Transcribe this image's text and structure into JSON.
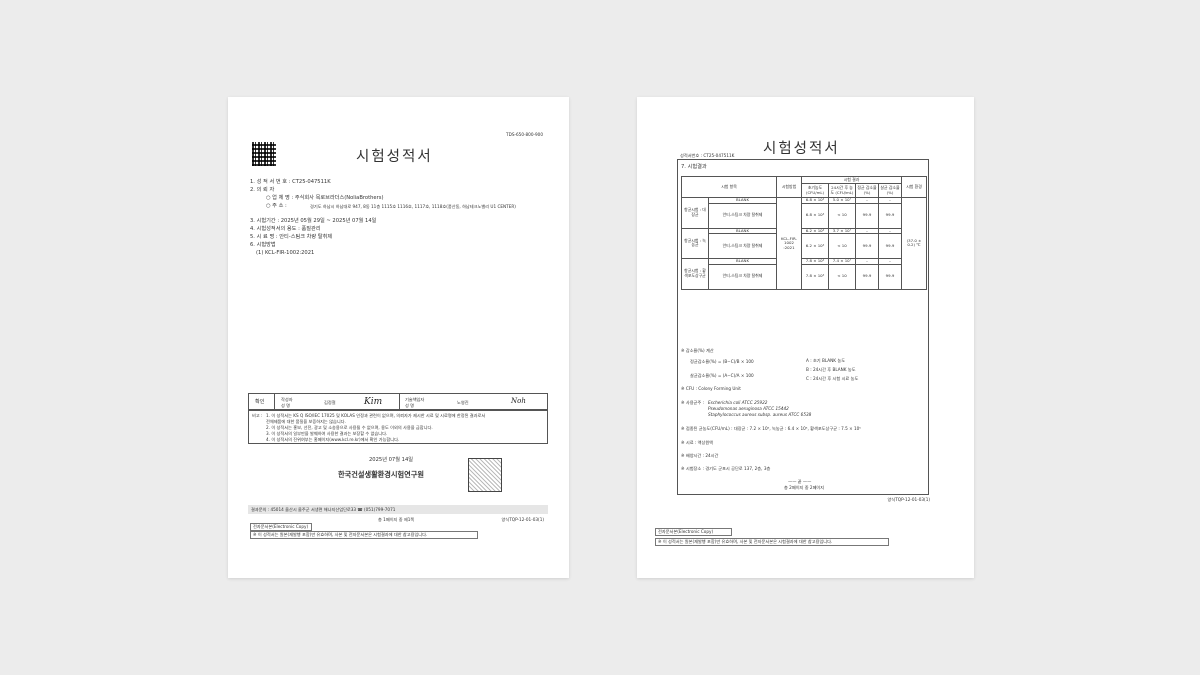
{
  "page1": {
    "doc_code": "TDS-650-800-900",
    "title": "시험성적서",
    "items": [
      {
        "label": "1. 성 적 서 번 호 :",
        "value": "CT25-047511K"
      },
      {
        "label": "2. 의 뢰 자",
        "value": ""
      },
      {
        "label": "○ 업 체 명 :",
        "value": "주식회사 목로브라더스(NoliaBrothers)"
      },
      {
        "label": "○ 주      소 :",
        "value": "경기도 하남시 하남대로 947, 8동 11층 1115호 1116호, 1117호, 1118호(풍산동, 하남테크노밸리 U1 CENTER)"
      },
      {
        "label": "3. 시험기간 :",
        "value": "2025년 05월 29일 ~ 2025년 07월 14일"
      },
      {
        "label": "4. 시험성적서의 용도 :",
        "value": "품질관리"
      },
      {
        "label": "5. 시 료 명 :",
        "value": "안티-스팀크 차량 탈취제"
      },
      {
        "label": "6. 시험방법",
        "value": ""
      },
      {
        "label": "(1) KCL-FIR-1002:2021",
        "value": ""
      }
    ],
    "confirm": {
      "label": "확인",
      "writer_role": "작성자",
      "writer_name_label": "성 명",
      "writer_name": "김정철",
      "approver_role": "기술책임자",
      "approver_name_label": "성 명",
      "approver_name": "노영진"
    },
    "notes_label": "비고 :",
    "notes": [
      "1. 이 성적서는 KS Q ISO/IEC 17025 및 KOLAS 인정과 관련이 없으며, 의뢰자가 제시한 시료 및 시료명에 한정된 결과로서",
      "    전체제품에 대한 품질을 보증하지는 않습니다.",
      "2. 이 성적서는 홍보, 선전, 광고 및 소송용으로 사용될 수 없으며, 용도 이외의 사용을 금합니다.",
      "3. 이 성적서의 일부만을 발췌하여 사용한 결과는 보장할 수 없습니다.",
      "4. 이 성적서의 진위여부는 홈페이지(www.kcl.re.kr)에서 확인 가능합니다."
    ],
    "date": "2025년 07월 14일",
    "institute": "한국건설생활환경시험연구원",
    "footer_address": "결과문의 : 45014  울산시 울주군 서생면 해나지산업단로33  ☎ (051)799-7071",
    "footer_page": "총 1페이지 중 제1쪽",
    "footer_form": "양식TQP-12-01-03(1)",
    "ecopy_label": "전자문서본(Electronic Copy)",
    "ecopy_note": "※ 이 성적서는 원본(재발행 포함)만 유효하며, 사본 및 전자문서본은 시험결과에 대한 참고용입니다."
  },
  "page2": {
    "title": "시험성적서",
    "report_no": "성적서번호 : CT25-047511K",
    "section": "7. 시험결과",
    "headers": {
      "item": "시험 항목",
      "method": "시험방법",
      "result_group": "시험 결과",
      "initial": "초기농도 (CFU/mL)",
      "after": "24시간 후 농도 (CFU/mL)",
      "static_rate": "정균 감소율 (%)",
      "kill_rate": "살균 감소율 (%)",
      "env": "시험 환경"
    },
    "rows": [
      {
        "group": "항균시험 : 대장균",
        "sample": "BLANK",
        "initial": "6.8 × 10⁴",
        "after": "5.0 × 10⁷",
        "static": "–",
        "kill": "–"
      },
      {
        "group": "",
        "sample": "안티-스팀크 차량 탈취제",
        "initial": "6.8 × 10⁴",
        "after": "< 10",
        "static": "99.9",
        "kill": "99.9"
      },
      {
        "group": "항균시험 : 녹농균",
        "sample": "BLANK",
        "initial": "6.2 × 10⁴",
        "after": "3.7 × 10⁷",
        "static": "–",
        "kill": "–"
      },
      {
        "group": "",
        "sample": "안티-스팀크 차량 탈취제",
        "initial": "6.2 × 10⁴",
        "after": "< 10",
        "static": "99.9",
        "kill": "99.9"
      },
      {
        "group": "항균시험 : 황색포도상구균",
        "sample": "BLANK",
        "initial": "7.8 × 10⁴",
        "after": "7.4 × 10⁷",
        "static": "–",
        "kill": "–"
      },
      {
        "group": "",
        "sample": "안티-스팀크 차량 탈취제",
        "initial": "7.8 × 10⁴",
        "after": "< 10",
        "static": "99.9",
        "kill": "99.9"
      }
    ],
    "method_value": "KCL-FIR-1002 :2021",
    "env_value": "(37.0 ± 0.2) ℃",
    "calc_title": "※ 감소율(%) 계산",
    "formula1": "정균감소율(%) = (B−C)/B × 100",
    "formula2": "살균감소율(%) = (A−C)/A × 100",
    "legend": [
      "A : 초기 BLANK 농도",
      "B : 24시간 후 BLANK 농도",
      "C : 24시간 후 시험 시료 농도"
    ],
    "cfu_note": "※ CFU : Colony Forming Unit",
    "strain_label": "※ 사용균주 :",
    "strains": [
      "Escherichia coli ATCC 25922",
      "Pseudomonas aeruginosa ATCC 15442",
      "Staphylococcus aureus subsp. aureus ATCC 6538"
    ],
    "inoculum": "※ 접종된 균농도(CFU/mL) : 대장균 : 7.2 × 10⁵, 녹농균 : 6.4 × 10⁵, 황색포도상구균 : 7.5 × 10⁵",
    "sample_note": "※ 시료 : 액상원액",
    "time_note": "※ 배양시간 : 24시간",
    "place_note": "※ 시험장소 : 경기도 군포시 공단로 137, 2층, 3층",
    "end_mark": "—— 끝 ——",
    "page_no": "총 2페이지 중 2페이지",
    "form": "양식TQP-12-01-03(1)",
    "ecopy_label": "전자문서본(Electronic Copy)",
    "ecopy_note": "※ 이 성적서는 원본(재발행 포함)만 유효하며, 사본 및 전자문서본은 시험결과에 대한 참고용입니다."
  }
}
